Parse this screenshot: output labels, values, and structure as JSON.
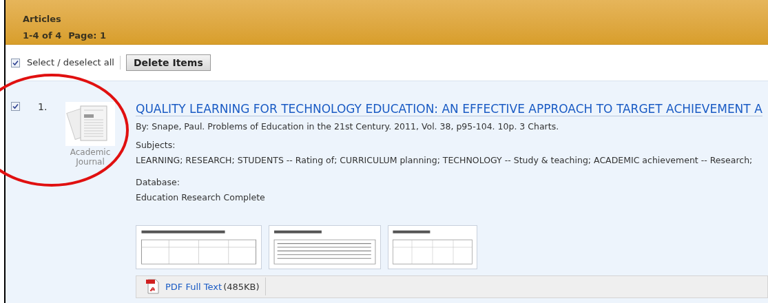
{
  "header": {
    "title": "Articles",
    "range": "1-4 of 4",
    "page_label": "Page:",
    "page": "1"
  },
  "toolbar": {
    "select_all": {
      "label": "Select / deselect all",
      "checked": true
    },
    "delete_button": "Delete Items"
  },
  "results": [
    {
      "number": "1.",
      "checked": true,
      "type_label": [
        "Academic",
        "Journal"
      ],
      "title": "QUALITY LEARNING FOR TECHNOLOGY EDUCATION: AN EFFECTIVE APPROACH TO TARGET ACHIEVEMENT A",
      "byline": "By: Snape, Paul. Problems of Education in the 21st Century. 2011, Vol. 38, p95-104. 10p. 3 Charts.",
      "subjects_label": "Subjects:",
      "subjects": "LEARNING; RESEARCH; STUDENTS -- Rating of; CURRICULUM planning; TECHNOLOGY -- Study & teaching; ACADEMIC achievement -- Research;",
      "database_label": "Database:",
      "database": "Education Research Complete",
      "thumbnails": [
        {
          "kind": "table"
        },
        {
          "kind": "text"
        },
        {
          "kind": "table"
        }
      ],
      "full_text": {
        "link": "PDF Full Text",
        "size": "(485KB)"
      }
    }
  ],
  "annotation": {
    "circled": true
  }
}
